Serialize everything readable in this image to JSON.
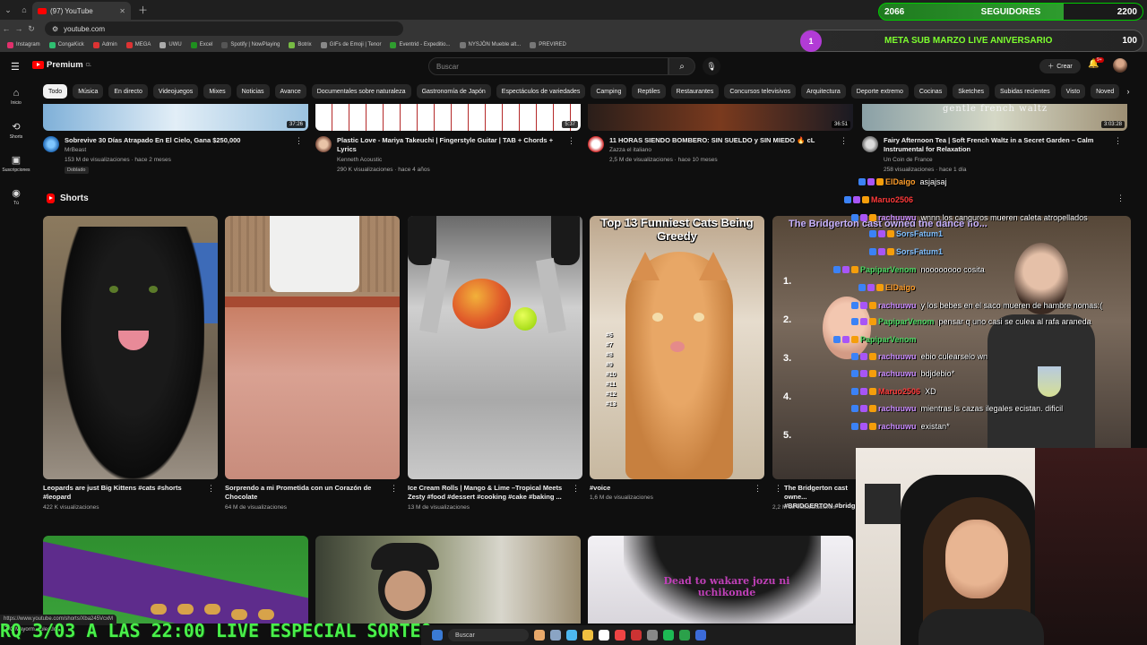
{
  "browser": {
    "tab_title": "(97) YouTube",
    "url": "youtube.com",
    "bookmarks": [
      "Instagram",
      "CongaKick",
      "Admin",
      "MEGA",
      "UWU",
      "Excel",
      "Spotify | NowPlaying",
      "Botrix",
      "GIFs de Emoji | Tenor",
      "Eventrid - Expeditio...",
      "NYSJÖN Mueble alt...",
      "PREVIRED"
    ]
  },
  "overlay": {
    "followers_current": "2066",
    "followers_label": "SEGUIDORES",
    "followers_goal": "2200",
    "followers_progress": 0.7,
    "sub_current": "1",
    "sub_label": "META SUB MARZO LIVE ANIVERSARIO",
    "sub_goal": "100",
    "ticker": "RQ 3/03 A LAS 22:00 LIVE ESPECIAL SORTEO"
  },
  "header": {
    "logo": "Premium",
    "logo_region": "CL",
    "search_placeholder": "Buscar",
    "create_label": "Crear",
    "notif_count": "9+"
  },
  "sidebar": [
    {
      "label": "Inicio",
      "icon": "home-icon"
    },
    {
      "label": "Shorts",
      "icon": "shorts-icon"
    },
    {
      "label": "Suscripciones",
      "icon": "subscriptions-icon"
    },
    {
      "label": "Tú",
      "icon": "you-icon"
    }
  ],
  "chips": [
    "Todo",
    "Música",
    "En directo",
    "Videojuegos",
    "Mixes",
    "Noticias",
    "Avance",
    "Documentales sobre naturaleza",
    "Gastronomía de Japón",
    "Espectáculos de variedades",
    "Camping",
    "Reptiles",
    "Restaurantes",
    "Concursos televisivos",
    "Arquitectura",
    "Deporte extremo",
    "Cocinas",
    "Sketches",
    "Subidas recientes",
    "Visto",
    "Noved"
  ],
  "videos": [
    {
      "title": "Sobrevive 30 Días Atrapado En El Cielo, Gana $250,000",
      "channel": "MrBeast",
      "stats": "153 M de visualizaciones · hace 2 meses",
      "badge": "Doblado",
      "duration": "37:26"
    },
    {
      "title": "Plastic Love - Mariya Takeuchi | Fingerstyle Guitar | TAB + Chords + Lyrics",
      "channel": "Kenneth Acoustic",
      "stats": "290 K visualizaciones · hace 4 años",
      "duration": "5:37"
    },
    {
      "title": "11 HORAS SIENDO BOMBERO: SIN SUELDO y SIN MIEDO 🔥 cL",
      "channel": "Zazza el italiano",
      "stats": "2,5 M de visualizaciones · hace 10 meses",
      "duration": "36:51"
    },
    {
      "title": "Fairy Afternoon Tea | Soft French Waltz in a Secret Garden – Calm Instrumental for Relaxation",
      "channel": "Un Coin de France",
      "stats": "258 visualizaciones · hace 1 día",
      "duration": "3:03:28",
      "thumb_text": "gentle french waltz"
    }
  ],
  "shorts": {
    "title": "Shorts",
    "items": [
      {
        "title": "Leopards are just Big Kittens #cats #shorts #leopard",
        "stats": "422 K visualizaciones"
      },
      {
        "title": "Sorprendo a mi Prometida con un Corazón de Chocolate",
        "stats": "64 M de visualizaciones"
      },
      {
        "title": "Ice Cream Rolls | Mango & Lime –Tropical Meets Zesty #food #dessert #cooking #cake #baking ...",
        "stats": "13 M de visualizaciones"
      },
      {
        "title": "#voice",
        "stats": "1,6 M de visualizaciones",
        "thumb_text": "Top 13 Funniest Cats Being Greedy",
        "list": [
          "#6",
          "#7",
          "#8",
          "#9",
          "#10",
          "#11",
          "#12",
          "#13"
        ]
      },
      {
        "title": "The Bridgerton cast owne... #BRIDGERTON #bridg",
        "stats": "2,2 M de visualizaciones",
        "thumb_text": "The Bridgerton cast owned the dance flo...",
        "nums": [
          "1.",
          "2.",
          "3.",
          "4.",
          "5."
        ]
      }
    ]
  },
  "bottom_row": [
    {
      "label": "football-field-dogs"
    },
    {
      "label": "man-in-cap"
    },
    {
      "thumb_text": "Dead to wakare jozu ni uchikonde"
    }
  ],
  "chat": [
    {
      "user": "ElDaigo",
      "msg": "asjajsaj",
      "color": "#ff9e2b"
    },
    {
      "user": "Maruo2506",
      "msg": "",
      "color": "#ff3a3a"
    },
    {
      "user": "rachuuwu",
      "msg": "wnnn los canguros mueren caleta atropellados",
      "color": "#c98bff"
    },
    {
      "user": "SorsFatum1",
      "msg": "",
      "color": "#7fbfff"
    },
    {
      "user": "SorsFatum1",
      "msg": "",
      "color": "#7fbfff"
    },
    {
      "user": "PapiparVenom",
      "msg": "noooooooo cosita",
      "color": "#4cd964"
    },
    {
      "user": "ElDaigo",
      "msg": "",
      "color": "#ff9e2b"
    },
    {
      "user": "rachuuwu",
      "msg": "y los bebes en el saco mueren de hambre nomas:(",
      "color": "#c98bff"
    },
    {
      "user": "PapiparVenom",
      "msg": "pensar q uno casi se culea al rafa araneda",
      "color": "#4cd964"
    },
    {
      "user": "PapiparVenom",
      "msg": "",
      "color": "#4cd964"
    },
    {
      "user": "rachuuwu",
      "msg": "ebio culearselo wn",
      "color": "#c98bff"
    },
    {
      "user": "rachuuwu",
      "msg": "bdjdebio*",
      "color": "#c98bff"
    },
    {
      "user": "Maruo2506",
      "msg": "XD",
      "color": "#ff3a3a"
    },
    {
      "user": "rachuuwu",
      "msg": "mientras ls cazas ilegales ecistan. dificil",
      "color": "#c98bff"
    },
    {
      "user": "rachuuwu",
      "msg": "existan*",
      "color": "#c98bff"
    }
  ],
  "status": {
    "hover_url": "https://www.youtube.com/shorts/Xba245VcxM",
    "weather": "27°C Mayorm. soleado",
    "taskbar_search": "Buscar"
  },
  "colors": {
    "background": "#0f0f0f",
    "accent": "#ff0000",
    "overlay_green": "#49f04a",
    "sub_bubble": "#b23bd6"
  }
}
